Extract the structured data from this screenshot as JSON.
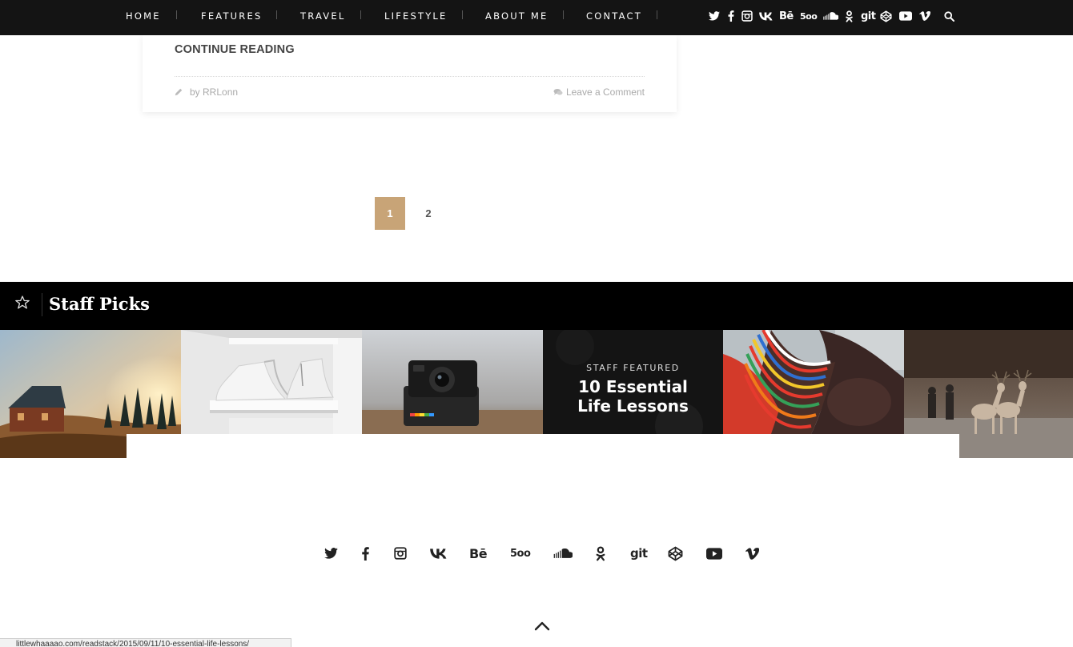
{
  "nav": {
    "items": [
      {
        "label": "HOME"
      },
      {
        "label": "FEATURES"
      },
      {
        "label": "TRAVEL"
      },
      {
        "label": "LIFESTYLE"
      },
      {
        "label": "ABOUT ME"
      },
      {
        "label": "CONTACT"
      }
    ],
    "social_icons": [
      "twitter-icon",
      "facebook-icon",
      "instagram-icon",
      "vk-icon",
      "behance-icon",
      "500px-icon",
      "soundcloud-icon",
      "odnoklassniki-icon",
      "git-icon",
      "codepen-icon",
      "youtube-icon",
      "vimeo-icon"
    ],
    "search_icon": "search-icon"
  },
  "post": {
    "continue_label": "CONTINUE READING",
    "byline": "by RRLonn",
    "comment_label": "Leave a Comment"
  },
  "pagination": {
    "pages": [
      "1",
      "2"
    ],
    "current": "1",
    "accent_color": "#c8a477"
  },
  "staff_picks": {
    "title": "Staff Picks",
    "featured_kicker": "STAFF FEATURED",
    "featured_title_line1": "10 Essential",
    "featured_title_line2": "Life Lessons"
  },
  "footer": {
    "social_icons": [
      "twitter-icon",
      "facebook-icon",
      "instagram-icon",
      "vk-icon",
      "behance-icon",
      "500px-icon",
      "soundcloud-icon",
      "odnoklassniki-icon",
      "git-icon",
      "codepen-icon",
      "youtube-icon",
      "vimeo-icon"
    ],
    "back_to_top_icon": "chevron-up-icon"
  },
  "status_bar": {
    "url": "littlewhaaaao.com/readstack/2015/09/11/10-essential-life-lessons/"
  },
  "icon_words": {
    "behance": "Bē",
    "fivehundred": "5oo",
    "git": "git"
  }
}
